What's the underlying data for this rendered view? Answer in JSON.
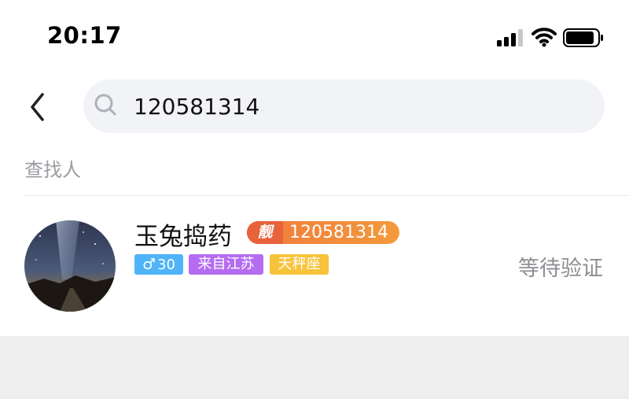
{
  "status_bar": {
    "time": "20:17",
    "icons": [
      "signal-icon",
      "wifi-icon",
      "battery-icon"
    ]
  },
  "nav": {
    "back_icon": "chevron-left-icon",
    "search": {
      "icon": "search-icon",
      "value": "120581314"
    }
  },
  "section": {
    "label": "查找人"
  },
  "result": {
    "name": "玉兔捣药",
    "badge_label": "靓",
    "id": "120581314",
    "tags": {
      "age": "30",
      "from": "来自江苏",
      "zodiac": "天秤座"
    },
    "status": "等待验证"
  },
  "colors": {
    "search_bg": "#f2f3f7",
    "badge_orange": "#f07a3c",
    "tag_blue": "#4fb3f7",
    "tag_purple": "#b56cf0",
    "tag_yellow": "#f7c33a",
    "bottom_bg": "#eeeeef"
  }
}
